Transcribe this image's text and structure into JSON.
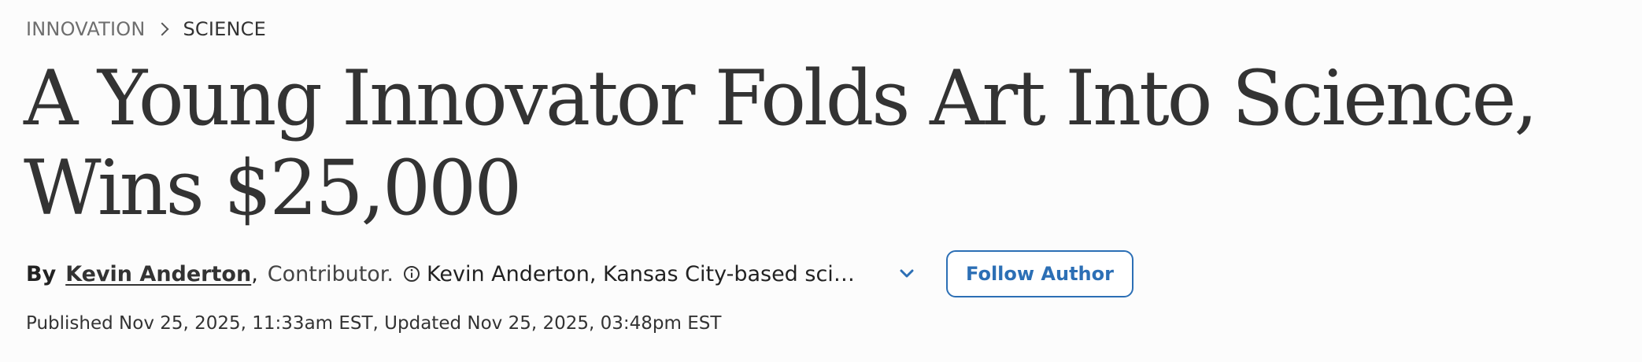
{
  "breadcrumb": {
    "parent": "INNOVATION",
    "current": "SCIENCE"
  },
  "article": {
    "headline": "A Young Innovator Folds Art Into Science, Wins $25,000",
    "byline": {
      "prefix": "By",
      "author": "Kevin Anderton",
      "separator": ",",
      "role": "Contributor.",
      "bio": "Kevin Anderton, Kansas City-based scienc..."
    },
    "follow_label": "Follow Author",
    "dates": "Published Nov 25, 2025, 11:33am EST, Updated Nov 25, 2025, 03:48pm EST"
  },
  "icons": {
    "breadcrumb_separator": "chevron-right-icon",
    "bio_info": "info-icon",
    "expand": "chevron-down-icon"
  },
  "colors": {
    "background": "#fcfcfc",
    "text": "#333333",
    "accent": "#2c6fb5"
  }
}
